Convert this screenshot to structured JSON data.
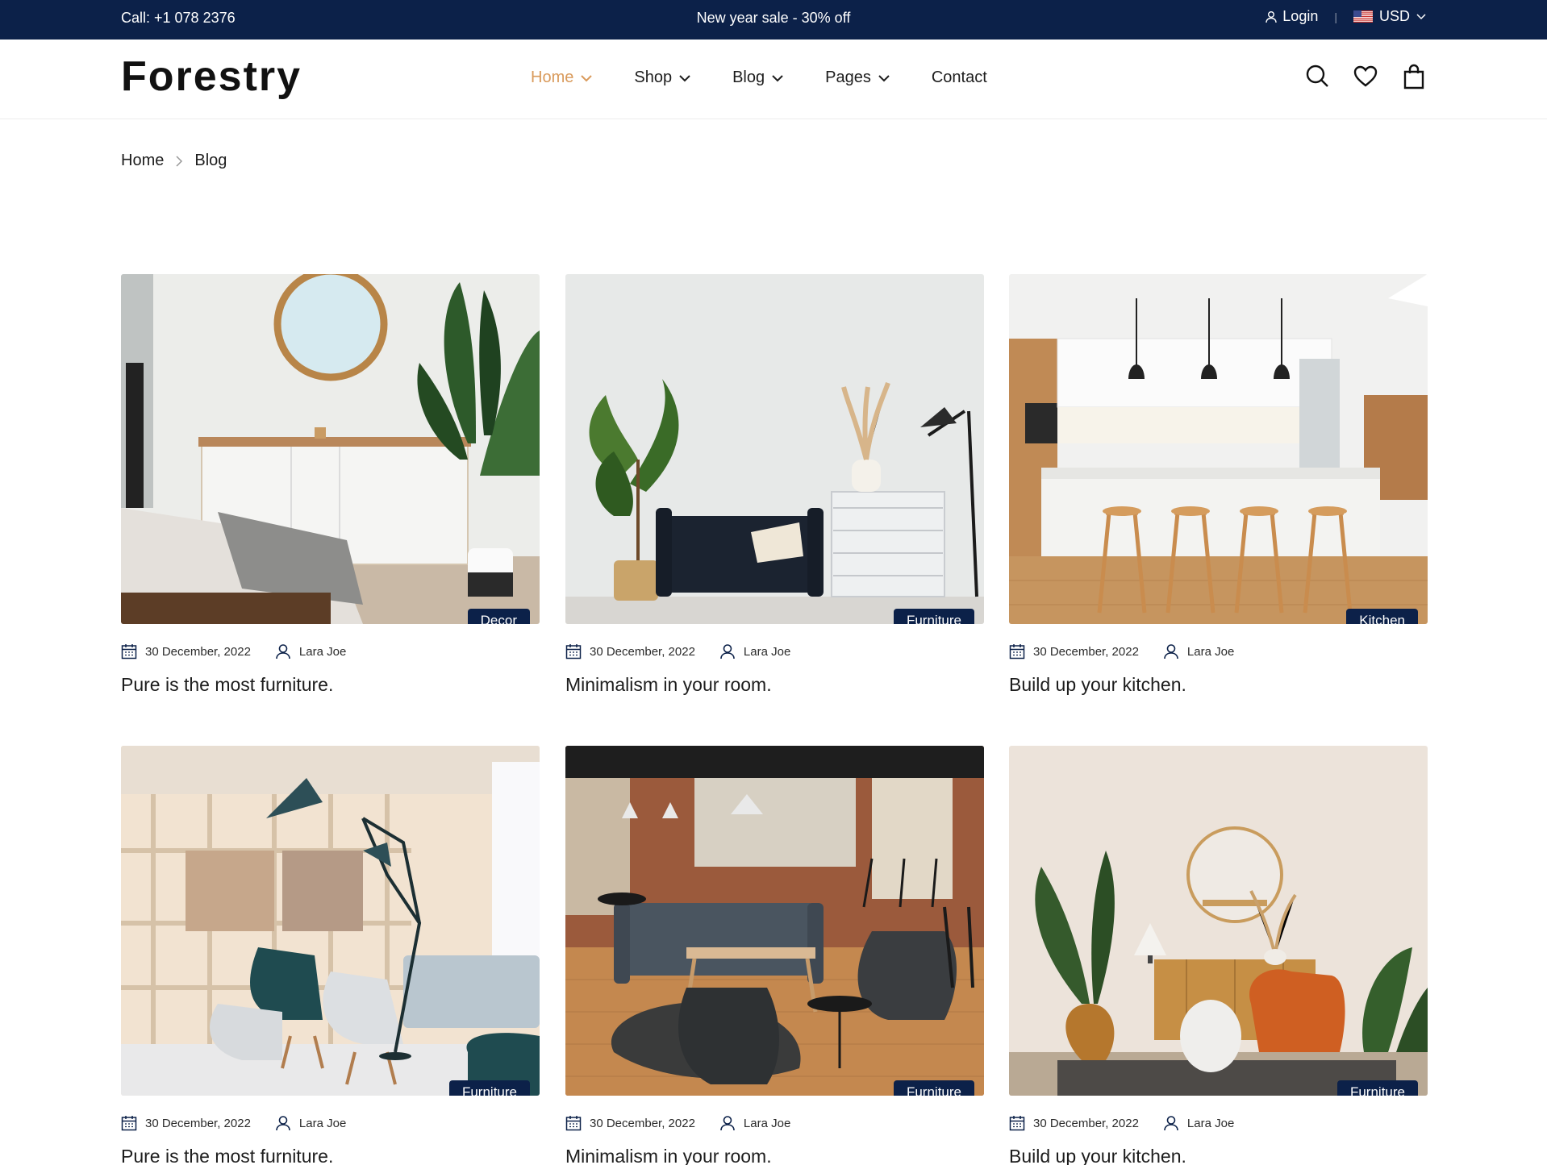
{
  "topbar": {
    "call": "Call: +1 078 2376",
    "promo": "New year sale - 30% off",
    "login": "Login",
    "currency": "USD"
  },
  "header": {
    "logo": "Forestry",
    "nav": [
      {
        "label": "Home",
        "active": true
      },
      {
        "label": "Shop"
      },
      {
        "label": "Blog"
      },
      {
        "label": "Pages"
      },
      {
        "label": "Contact"
      }
    ]
  },
  "breadcrumb": {
    "home": "Home",
    "current": "Blog"
  },
  "posts": [
    {
      "title": "Pure is the most furniture.",
      "date": "30 December, 2022",
      "author": "Lara Joe",
      "category": "Decor"
    },
    {
      "title": "Minimalism in your room.",
      "date": "30 December, 2022",
      "author": "Lara Joe",
      "category": "Furniture"
    },
    {
      "title": "Build up your kitchen.",
      "date": "30 December, 2022",
      "author": "Lara Joe",
      "category": "Kitchen"
    },
    {
      "title": "Pure is the most furniture.",
      "date": "30 December, 2022",
      "author": "Lara Joe",
      "category": "Furniture"
    },
    {
      "title": "Minimalism in your room.",
      "date": "30 December, 2022",
      "author": "Lara Joe",
      "category": "Furniture"
    },
    {
      "title": "Build up your kitchen.",
      "date": "30 December, 2022",
      "author": "Lara Joe",
      "category": "Furniture"
    }
  ],
  "colors": {
    "navy": "#0c2149",
    "accent": "#d99a5b"
  }
}
